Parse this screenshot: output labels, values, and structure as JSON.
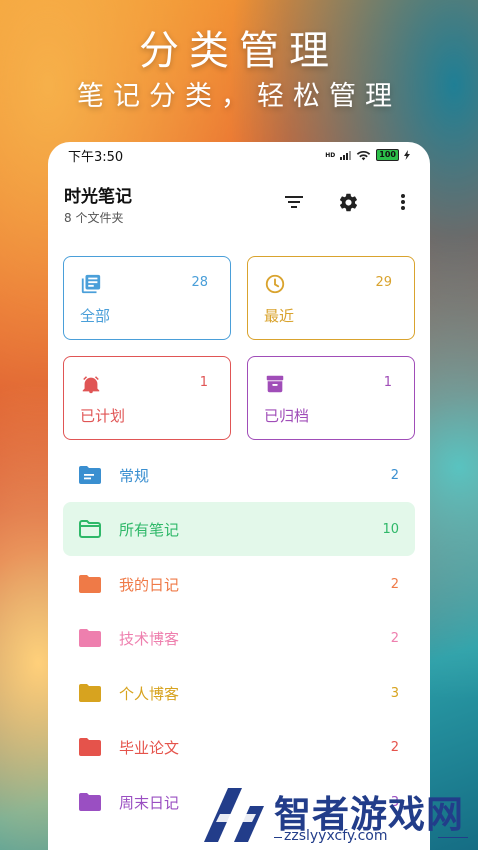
{
  "hero": {
    "title": "分类管理",
    "subtitle": "笔记分类，轻松管理"
  },
  "status_bar": {
    "time": "下午3:50",
    "hd": "HD",
    "battery": "100"
  },
  "app": {
    "title": "时光笔记",
    "subtitle": "8 个文件夹",
    "actions": [
      "filter-icon",
      "settings-icon",
      "more-vert-icon"
    ]
  },
  "cards": [
    {
      "label": "全部",
      "count": "28",
      "color": "#4a9fd9",
      "icon": "library-books-icon"
    },
    {
      "label": "最近",
      "count": "29",
      "color": "#d9a32e",
      "icon": "clock-icon"
    },
    {
      "label": "已计划",
      "count": "1",
      "color": "#e05555",
      "icon": "alarm-icon"
    },
    {
      "label": "已归档",
      "count": "1",
      "color": "#a04db8",
      "icon": "archive-icon"
    }
  ],
  "folders": [
    {
      "label": "常规",
      "count": "2",
      "color": "#3a8fd0",
      "icon": "folder-notes-icon",
      "selected": false
    },
    {
      "label": "所有笔记",
      "count": "10",
      "color": "#2fb869",
      "icon": "folder-outline-icon",
      "selected": true
    },
    {
      "label": "我的日记",
      "count": "2",
      "color": "#ef7a47",
      "icon": "folder-icon",
      "selected": false
    },
    {
      "label": "技术博客",
      "count": "2",
      "color": "#ee7fae",
      "icon": "folder-icon",
      "selected": false
    },
    {
      "label": "个人博客",
      "count": "3",
      "color": "#d7a31f",
      "icon": "folder-icon",
      "selected": false
    },
    {
      "label": "毕业论文",
      "count": "2",
      "color": "#e5534b",
      "icon": "folder-icon",
      "selected": false
    },
    {
      "label": "周末日记",
      "count": "3",
      "color": "#9a4fc2",
      "icon": "folder-icon",
      "selected": false
    }
  ],
  "watermark": {
    "brand": "智者游戏网",
    "url": "zzslyyxcfy.com"
  }
}
